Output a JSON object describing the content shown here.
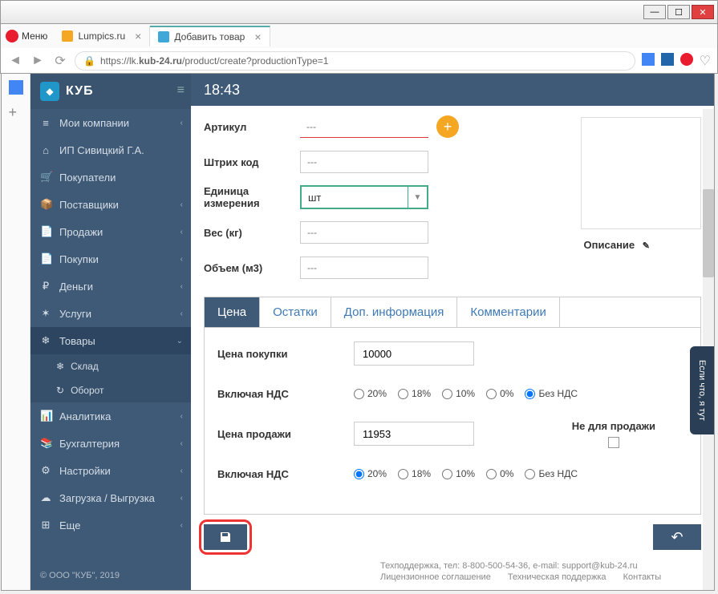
{
  "window": {
    "menu_label": "Меню"
  },
  "tabs": [
    {
      "title": "Lumpics.ru",
      "icon_color": "#f5a623"
    },
    {
      "title": "Добавить товар",
      "icon_color": "#3fa8d8"
    }
  ],
  "url": {
    "prefix": "https://lk.",
    "bold": "kub-24.ru",
    "rest": "/product/create?productionType=1"
  },
  "brand": "КУБ",
  "header_time": "18:43",
  "sidebar": {
    "items": [
      {
        "label": "Мои компании",
        "icon": "≡"
      },
      {
        "label": "ИП Сивицкий Г.А.",
        "icon": "⌂"
      },
      {
        "label": "Покупатели",
        "icon": "🛒"
      },
      {
        "label": "Поставщики",
        "icon": "📦"
      },
      {
        "label": "Продажи",
        "icon": "📄"
      },
      {
        "label": "Покупки",
        "icon": "📄"
      },
      {
        "label": "Деньги",
        "icon": "₽"
      },
      {
        "label": "Услуги",
        "icon": "✶"
      },
      {
        "label": "Товары",
        "icon": "❄"
      },
      {
        "label": "Аналитика",
        "icon": "📊"
      },
      {
        "label": "Бухгалтерия",
        "icon": "📚"
      },
      {
        "label": "Настройки",
        "icon": "⚙"
      },
      {
        "label": "Загрузка / Выгрузка",
        "icon": "☁"
      },
      {
        "label": "Еще",
        "icon": "⊞"
      }
    ],
    "sub": [
      {
        "label": "Склад",
        "icon": "❄"
      },
      {
        "label": "Оборот",
        "icon": "↻"
      }
    ],
    "copyright": "© ООО \"КУБ\", 2019"
  },
  "form": {
    "article_label": "Артикул",
    "article_placeholder": "---",
    "barcode_label": "Штрих код",
    "barcode_placeholder": "---",
    "unit_label": "Единица измерения",
    "unit_value": "шт",
    "weight_label": "Вес (кг)",
    "weight_placeholder": "---",
    "volume_label": "Объем (м3)",
    "volume_placeholder": "---",
    "description_label": "Описание"
  },
  "price_tabs": [
    {
      "label": "Цена"
    },
    {
      "label": "Остатки"
    },
    {
      "label": "Доп. информация"
    },
    {
      "label": "Комментарии"
    }
  ],
  "price": {
    "buy_label": "Цена покупки",
    "buy_value": "10000",
    "vat1_label": "Включая НДС",
    "sell_label": "Цена продажи",
    "sell_value": "11953",
    "vat2_label": "Включая НДС",
    "not_for_sale": "Не для продажи",
    "vat_options": [
      "20%",
      "18%",
      "10%",
      "0%",
      "Без НДС"
    ]
  },
  "footer": {
    "support": "Техподдержка, тел: 8-800-500-54-36, e-mail: support@kub-24.ru",
    "links": [
      "Лицензионное соглашение",
      "Техническая поддержка",
      "Контакты"
    ]
  },
  "feedback": "Если что, я тут"
}
